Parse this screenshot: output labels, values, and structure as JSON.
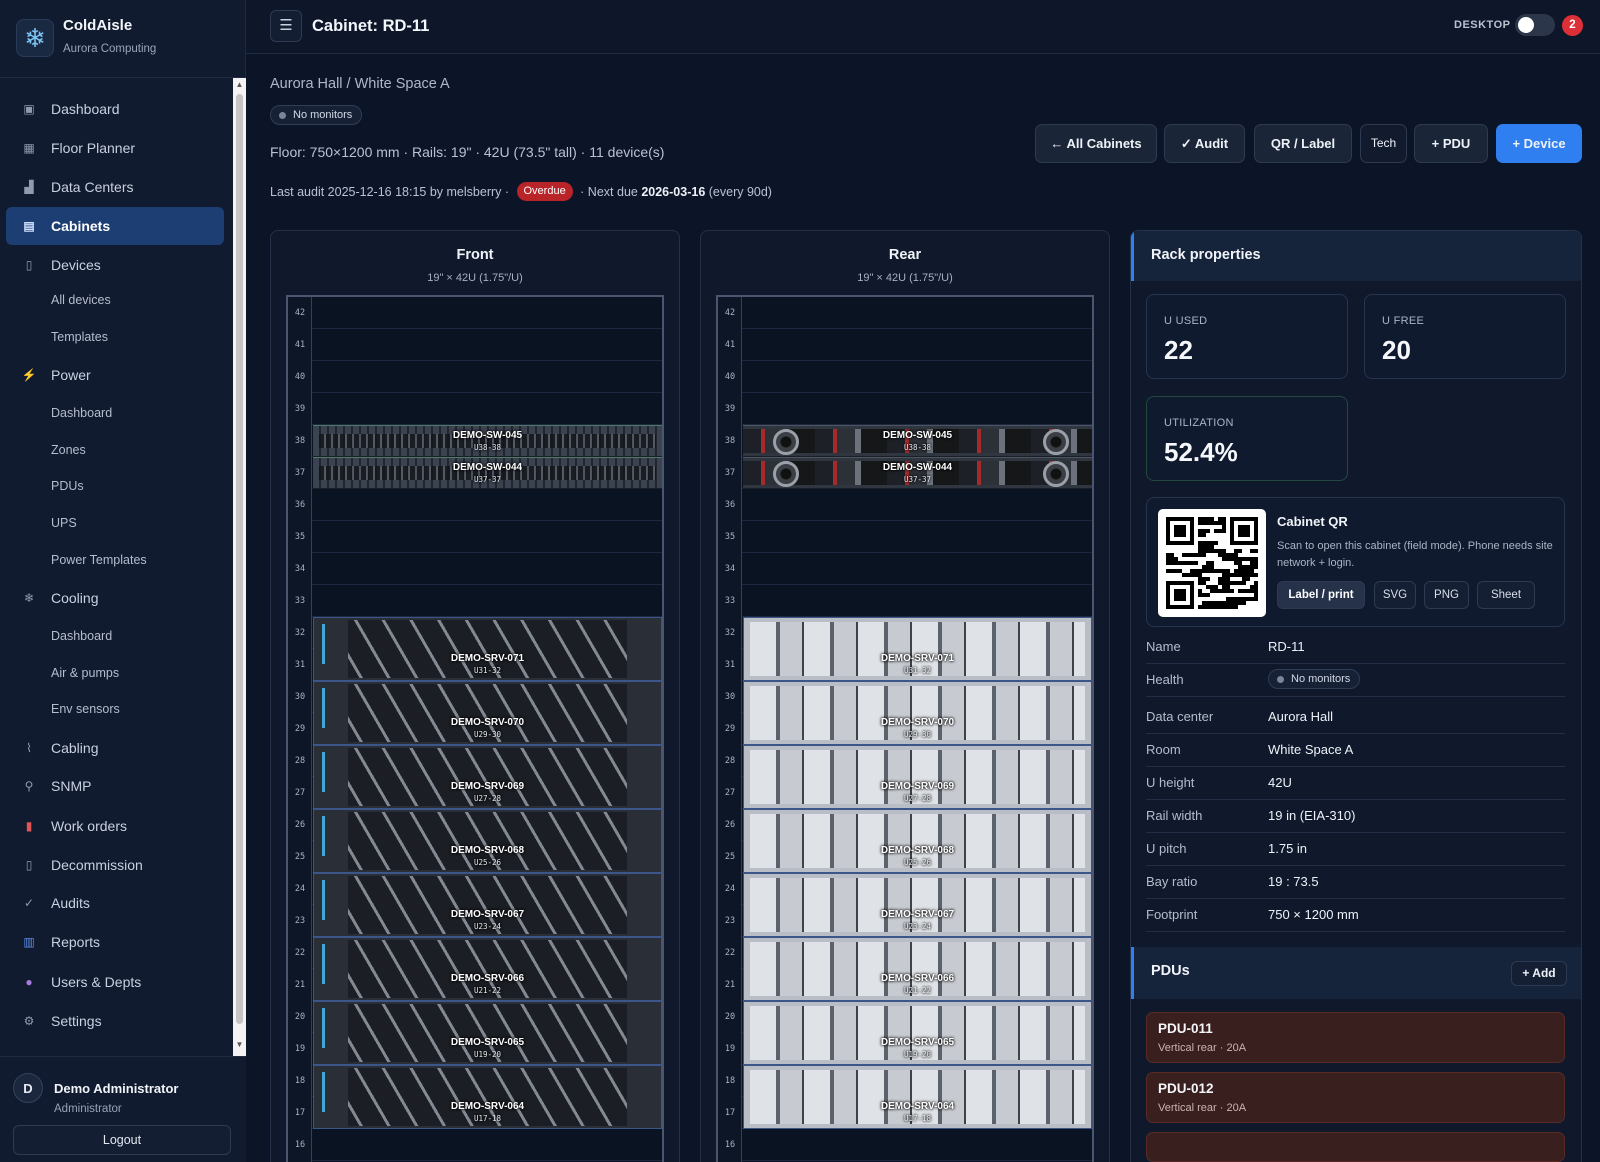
{
  "brand": {
    "name": "ColdAisle",
    "subtitle": "Aurora Computing",
    "logo_icon": "snowflake-icon"
  },
  "nav": [
    {
      "label": "Dashboard",
      "icon": "dashboard-icon",
      "active": false
    },
    {
      "label": "Floor Planner",
      "icon": "floor-planner-icon",
      "active": false
    },
    {
      "label": "Data Centers",
      "icon": "building-icon",
      "active": false
    },
    {
      "label": "Cabinets",
      "icon": "cabinet-icon",
      "active": true
    },
    {
      "label": "Devices",
      "icon": "device-icon",
      "active": false
    },
    {
      "label": "All devices",
      "sub": true
    },
    {
      "label": "Templates",
      "sub": true
    },
    {
      "label": "Power",
      "icon": "lightning-icon",
      "active": false
    },
    {
      "label": "Dashboard",
      "sub": true
    },
    {
      "label": "Zones",
      "sub": true
    },
    {
      "label": "PDUs",
      "sub": true
    },
    {
      "label": "UPS",
      "sub": true
    },
    {
      "label": "Power Templates",
      "sub": true
    },
    {
      "label": "Cooling",
      "icon": "snowflake-icon",
      "active": false
    },
    {
      "label": "Dashboard",
      "sub": true
    },
    {
      "label": "Air & pumps",
      "sub": true
    },
    {
      "label": "Env sensors",
      "sub": true
    },
    {
      "label": "Cabling",
      "icon": "cable-icon",
      "active": false
    },
    {
      "label": "SNMP",
      "icon": "satellite-icon",
      "active": false
    },
    {
      "label": "Work orders",
      "icon": "clipboard-icon",
      "active": false
    },
    {
      "label": "Decommission",
      "icon": "decommission-icon",
      "active": false
    },
    {
      "label": "Audits",
      "icon": "check-icon",
      "active": false
    },
    {
      "label": "Reports",
      "icon": "chart-icon",
      "active": false
    },
    {
      "label": "Users & Depts",
      "icon": "user-icon",
      "active": false
    },
    {
      "label": "Settings",
      "icon": "gear-icon",
      "active": false
    }
  ],
  "user": {
    "initial": "D",
    "name": "Demo Administrator",
    "role": "Administrator",
    "logout": "Logout"
  },
  "topbar": {
    "title": "Cabinet: RD-11",
    "mode_label": "DESKTOP",
    "notifications": "2"
  },
  "header": {
    "breadcrumb": "Aurora Hall / White Space A",
    "monitor_status": "No monitors",
    "floor_info": "Floor: 750×1200 mm · Rails: 19\" · 42U (73.5\" tall) · 11 device(s)",
    "audit_prefix": "Last audit 2025-12-16 18:15 by melsberry · ",
    "audit_badge": "Overdue",
    "audit_mid": " · Next due ",
    "audit_due": "2026-03-16",
    "audit_suffix": " (every 90d)"
  },
  "actions": {
    "all_cabinets": "← All Cabinets",
    "audit": "✓ Audit",
    "qr_label": "QR / Label",
    "tech": "Tech",
    "add_pdu": "+ PDU",
    "add_device": "+ Device"
  },
  "racks": {
    "front": {
      "title": "Front",
      "subtitle": "19\" × 42U (1.75\"/U)"
    },
    "rear": {
      "title": "Rear",
      "subtitle": "19\" × 42U (1.75\"/U)"
    },
    "u_labels_visible": [
      42,
      41,
      40,
      39,
      38,
      37,
      36,
      35,
      34,
      33,
      32,
      31,
      30,
      29,
      28,
      27,
      26,
      25,
      24,
      23,
      22,
      21,
      20,
      19,
      18,
      17,
      16
    ],
    "devices": [
      {
        "name": "DEMO-SW-045",
        "units": "U38-38",
        "type": "switch",
        "top_u": 38,
        "height_u": 1
      },
      {
        "name": "DEMO-SW-044",
        "units": "U37-37",
        "type": "switch",
        "top_u": 37,
        "height_u": 1
      },
      {
        "name": "DEMO-SRV-071",
        "units": "U31-32",
        "type": "server",
        "top_u": 32,
        "height_u": 2
      },
      {
        "name": "DEMO-SRV-070",
        "units": "U29-30",
        "type": "server",
        "top_u": 30,
        "height_u": 2
      },
      {
        "name": "DEMO-SRV-069",
        "units": "U27-28",
        "type": "server",
        "top_u": 28,
        "height_u": 2
      },
      {
        "name": "DEMO-SRV-068",
        "units": "U25-26",
        "type": "server",
        "top_u": 26,
        "height_u": 2
      },
      {
        "name": "DEMO-SRV-067",
        "units": "U23-24",
        "type": "server",
        "top_u": 24,
        "height_u": 2
      },
      {
        "name": "DEMO-SRV-066",
        "units": "U21-22",
        "type": "server",
        "top_u": 22,
        "height_u": 2
      },
      {
        "name": "DEMO-SRV-065",
        "units": "U19-20",
        "type": "server",
        "top_u": 20,
        "height_u": 2
      },
      {
        "name": "DEMO-SRV-064",
        "units": "U17-18",
        "type": "server",
        "top_u": 18,
        "height_u": 2
      }
    ]
  },
  "properties": {
    "title": "Rack properties",
    "stats": {
      "u_used_label": "U USED",
      "u_used": "22",
      "u_free_label": "U FREE",
      "u_free": "20",
      "util_label": "UTILIZATION",
      "util": "52.4%"
    },
    "qr": {
      "title": "Cabinet QR",
      "desc": "Scan to open this cabinet (field mode). Phone needs site network + login.",
      "btn_label": "Label / print",
      "btn_svg": "SVG",
      "btn_png": "PNG",
      "btn_sheet": "Sheet"
    },
    "rows": [
      {
        "key": "Name",
        "value": "RD-11"
      },
      {
        "key": "Health",
        "value": "No monitors"
      },
      {
        "key": "Data center",
        "value": "Aurora Hall"
      },
      {
        "key": "Room",
        "value": "White Space A"
      },
      {
        "key": "U height",
        "value": "42U"
      },
      {
        "key": "Rail width",
        "value": "19 in (EIA-310)"
      },
      {
        "key": "U pitch",
        "value": "1.75 in"
      },
      {
        "key": "Bay ratio",
        "value": "19 : 73.5"
      },
      {
        "key": "Footprint",
        "value": "750 × 1200 mm"
      }
    ]
  },
  "pdus": {
    "title": "PDUs",
    "add_label": "+ Add",
    "items": [
      {
        "name": "PDU-011",
        "desc": "Vertical rear · 20A"
      },
      {
        "name": "PDU-012",
        "desc": "Vertical rear · 20A"
      }
    ]
  }
}
